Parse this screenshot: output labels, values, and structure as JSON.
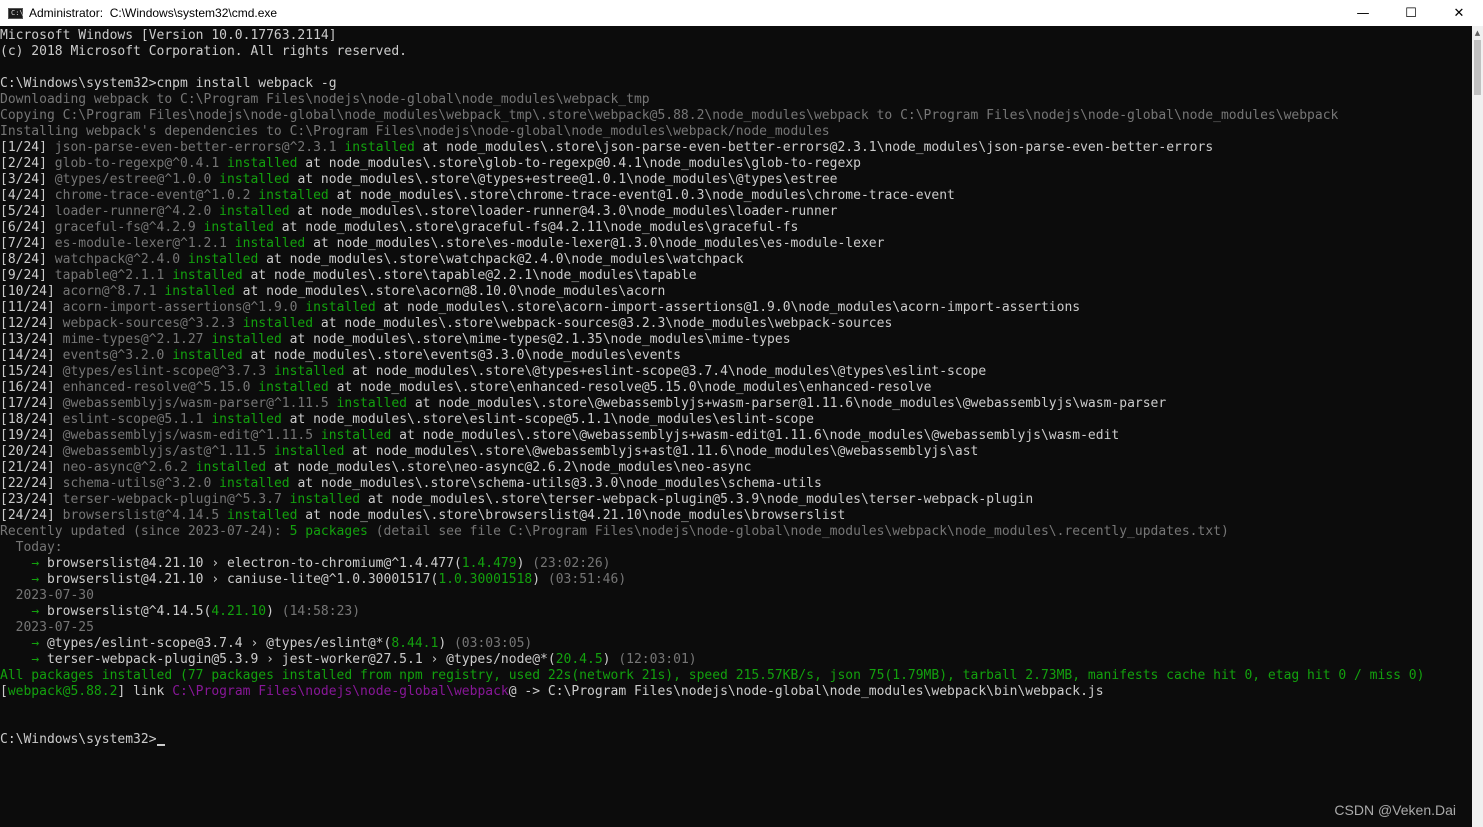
{
  "window": {
    "title": "Administrator:  C:\\Windows\\system32\\cmd.exe",
    "icon_glyph": "C:\\",
    "minimize_glyph": "—",
    "maximize_glyph": "☐",
    "close_glyph": "✕"
  },
  "colors": {
    "background": "#0c0c0c",
    "text": "#cccccc",
    "dim": "#767676",
    "green": "#13a10e",
    "purple": "#881798"
  },
  "console": {
    "lines": [
      [
        [
          "",
          "Microsoft Windows [Version 10.0.17763.2114]"
        ]
      ],
      [
        [
          "",
          "(c) 2018 Microsoft Corporation. All rights reserved."
        ]
      ],
      [],
      [
        [
          "",
          "C:\\Windows\\system32>cnpm install webpack -g"
        ]
      ],
      [
        [
          "dim",
          "Downloading webpack to C:\\Program Files\\nodejs\\node-global\\node_modules\\webpack_tmp"
        ]
      ],
      [
        [
          "dim",
          "Copying C:\\Program Files\\nodejs\\node-global\\node_modules\\webpack_tmp\\.store\\webpack@5.88.2\\node_modules\\webpack to C:\\Program Files\\nodejs\\node-global\\node_modules\\webpack"
        ]
      ],
      [
        [
          "dim",
          "Installing webpack's dependencies to C:\\Program Files\\nodejs\\node-global\\node_modules\\webpack/node_modules"
        ]
      ],
      [
        [
          "",
          "[1/24] "
        ],
        [
          "dim",
          "json-parse-even-better-errors@^2.3.1"
        ],
        [
          "green",
          " installed"
        ],
        [
          "",
          " at node_modules\\.store\\json-parse-even-better-errors@2.3.1\\node_modules\\json-parse-even-better-errors"
        ]
      ],
      [
        [
          "",
          "[2/24] "
        ],
        [
          "dim",
          "glob-to-regexp@^0.4.1"
        ],
        [
          "green",
          " installed"
        ],
        [
          "",
          " at node_modules\\.store\\glob-to-regexp@0.4.1\\node_modules\\glob-to-regexp"
        ]
      ],
      [
        [
          "",
          "[3/24] "
        ],
        [
          "dim",
          "@types/estree@^1.0.0"
        ],
        [
          "green",
          " installed"
        ],
        [
          "",
          " at node_modules\\.store\\@types+estree@1.0.1\\node_modules\\@types\\estree"
        ]
      ],
      [
        [
          "",
          "[4/24] "
        ],
        [
          "dim",
          "chrome-trace-event@^1.0.2"
        ],
        [
          "green",
          " installed"
        ],
        [
          "",
          " at node_modules\\.store\\chrome-trace-event@1.0.3\\node_modules\\chrome-trace-event"
        ]
      ],
      [
        [
          "",
          "[5/24] "
        ],
        [
          "dim",
          "loader-runner@^4.2.0"
        ],
        [
          "green",
          " installed"
        ],
        [
          "",
          " at node_modules\\.store\\loader-runner@4.3.0\\node_modules\\loader-runner"
        ]
      ],
      [
        [
          "",
          "[6/24] "
        ],
        [
          "dim",
          "graceful-fs@^4.2.9"
        ],
        [
          "green",
          " installed"
        ],
        [
          "",
          " at node_modules\\.store\\graceful-fs@4.2.11\\node_modules\\graceful-fs"
        ]
      ],
      [
        [
          "",
          "[7/24] "
        ],
        [
          "dim",
          "es-module-lexer@^1.2.1"
        ],
        [
          "green",
          " installed"
        ],
        [
          "",
          " at node_modules\\.store\\es-module-lexer@1.3.0\\node_modules\\es-module-lexer"
        ]
      ],
      [
        [
          "",
          "[8/24] "
        ],
        [
          "dim",
          "watchpack@^2.4.0"
        ],
        [
          "green",
          " installed"
        ],
        [
          "",
          " at node_modules\\.store\\watchpack@2.4.0\\node_modules\\watchpack"
        ]
      ],
      [
        [
          "",
          "[9/24] "
        ],
        [
          "dim",
          "tapable@^2.1.1"
        ],
        [
          "green",
          " installed"
        ],
        [
          "",
          " at node_modules\\.store\\tapable@2.2.1\\node_modules\\tapable"
        ]
      ],
      [
        [
          "",
          "[10/24] "
        ],
        [
          "dim",
          "acorn@^8.7.1"
        ],
        [
          "green",
          " installed"
        ],
        [
          "",
          " at node_modules\\.store\\acorn@8.10.0\\node_modules\\acorn"
        ]
      ],
      [
        [
          "",
          "[11/24] "
        ],
        [
          "dim",
          "acorn-import-assertions@^1.9.0"
        ],
        [
          "green",
          " installed"
        ],
        [
          "",
          " at node_modules\\.store\\acorn-import-assertions@1.9.0\\node_modules\\acorn-import-assertions"
        ]
      ],
      [
        [
          "",
          "[12/24] "
        ],
        [
          "dim",
          "webpack-sources@^3.2.3"
        ],
        [
          "green",
          " installed"
        ],
        [
          "",
          " at node_modules\\.store\\webpack-sources@3.2.3\\node_modules\\webpack-sources"
        ]
      ],
      [
        [
          "",
          "[13/24] "
        ],
        [
          "dim",
          "mime-types@^2.1.27"
        ],
        [
          "green",
          " installed"
        ],
        [
          "",
          " at node_modules\\.store\\mime-types@2.1.35\\node_modules\\mime-types"
        ]
      ],
      [
        [
          "",
          "[14/24] "
        ],
        [
          "dim",
          "events@^3.2.0"
        ],
        [
          "green",
          " installed"
        ],
        [
          "",
          " at node_modules\\.store\\events@3.3.0\\node_modules\\events"
        ]
      ],
      [
        [
          "",
          "[15/24] "
        ],
        [
          "dim",
          "@types/eslint-scope@^3.7.3"
        ],
        [
          "green",
          " installed"
        ],
        [
          "",
          " at node_modules\\.store\\@types+eslint-scope@3.7.4\\node_modules\\@types\\eslint-scope"
        ]
      ],
      [
        [
          "",
          "[16/24] "
        ],
        [
          "dim",
          "enhanced-resolve@^5.15.0"
        ],
        [
          "green",
          " installed"
        ],
        [
          "",
          " at node_modules\\.store\\enhanced-resolve@5.15.0\\node_modules\\enhanced-resolve"
        ]
      ],
      [
        [
          "",
          "[17/24] "
        ],
        [
          "dim",
          "@webassemblyjs/wasm-parser@^1.11.5"
        ],
        [
          "green",
          " installed"
        ],
        [
          "",
          " at node_modules\\.store\\@webassemblyjs+wasm-parser@1.11.6\\node_modules\\@webassemblyjs\\wasm-parser"
        ]
      ],
      [
        [
          "",
          "[18/24] "
        ],
        [
          "dim",
          "eslint-scope@5.1.1"
        ],
        [
          "green",
          " installed"
        ],
        [
          "",
          " at node_modules\\.store\\eslint-scope@5.1.1\\node_modules\\eslint-scope"
        ]
      ],
      [
        [
          "",
          "[19/24] "
        ],
        [
          "dim",
          "@webassemblyjs/wasm-edit@^1.11.5"
        ],
        [
          "green",
          " installed"
        ],
        [
          "",
          " at node_modules\\.store\\@webassemblyjs+wasm-edit@1.11.6\\node_modules\\@webassemblyjs\\wasm-edit"
        ]
      ],
      [
        [
          "",
          "[20/24] "
        ],
        [
          "dim",
          "@webassemblyjs/ast@^1.11.5"
        ],
        [
          "green",
          " installed"
        ],
        [
          "",
          " at node_modules\\.store\\@webassemblyjs+ast@1.11.6\\node_modules\\@webassemblyjs\\ast"
        ]
      ],
      [
        [
          "",
          "[21/24] "
        ],
        [
          "dim",
          "neo-async@^2.6.2"
        ],
        [
          "green",
          " installed"
        ],
        [
          "",
          " at node_modules\\.store\\neo-async@2.6.2\\node_modules\\neo-async"
        ]
      ],
      [
        [
          "",
          "[22/24] "
        ],
        [
          "dim",
          "schema-utils@^3.2.0"
        ],
        [
          "green",
          " installed"
        ],
        [
          "",
          " at node_modules\\.store\\schema-utils@3.3.0\\node_modules\\schema-utils"
        ]
      ],
      [
        [
          "",
          "[23/24] "
        ],
        [
          "dim",
          "terser-webpack-plugin@^5.3.7"
        ],
        [
          "green",
          " installed"
        ],
        [
          "",
          " at node_modules\\.store\\terser-webpack-plugin@5.3.9\\node_modules\\terser-webpack-plugin"
        ]
      ],
      [
        [
          "",
          "[24/24] "
        ],
        [
          "dim",
          "browserslist@^4.14.5"
        ],
        [
          "green",
          " installed"
        ],
        [
          "",
          " at node_modules\\.store\\browserslist@4.21.10\\node_modules\\browserslist"
        ]
      ],
      [
        [
          "dim",
          "Recently updated (since 2023-07-24): "
        ],
        [
          "green",
          "5 packages"
        ],
        [
          "dim",
          " (detail see file C:\\Program Files\\nodejs\\node-global\\node_modules\\webpack\\node_modules\\.recently_updates.txt)"
        ]
      ],
      [
        [
          "dim",
          "  Today:"
        ]
      ],
      [
        [
          "",
          "    "
        ],
        [
          "green",
          "→"
        ],
        [
          "",
          " browserslist@4.21.10 › electron-to-chromium@^1.4.477("
        ],
        [
          "green",
          "1.4.479"
        ],
        [
          "",
          ") "
        ],
        [
          "dim",
          "(23:02:26)"
        ]
      ],
      [
        [
          "",
          "    "
        ],
        [
          "green",
          "→"
        ],
        [
          "",
          " browserslist@4.21.10 › caniuse-lite@^1.0.30001517("
        ],
        [
          "green",
          "1.0.30001518"
        ],
        [
          "",
          ") "
        ],
        [
          "dim",
          "(03:51:46)"
        ]
      ],
      [
        [
          "dim",
          "  2023-07-30"
        ]
      ],
      [
        [
          "",
          "    "
        ],
        [
          "green",
          "→"
        ],
        [
          "",
          " browserslist@^4.14.5("
        ],
        [
          "green",
          "4.21.10"
        ],
        [
          "",
          ") "
        ],
        [
          "dim",
          "(14:58:23)"
        ]
      ],
      [
        [
          "dim",
          "  2023-07-25"
        ]
      ],
      [
        [
          "",
          "    "
        ],
        [
          "green",
          "→"
        ],
        [
          "",
          " @types/eslint-scope@3.7.4 › @types/eslint@*("
        ],
        [
          "green",
          "8.44.1"
        ],
        [
          "",
          ") "
        ],
        [
          "dim",
          "(03:03:05)"
        ]
      ],
      [
        [
          "",
          "    "
        ],
        [
          "green",
          "→"
        ],
        [
          "",
          " terser-webpack-plugin@5.3.9 › jest-worker@27.5.1 › @types/node@*("
        ],
        [
          "green",
          "20.4.5"
        ],
        [
          "",
          ") "
        ],
        [
          "dim",
          "(12:03:01)"
        ]
      ],
      [
        [
          "green",
          "All packages installed (77 packages installed from npm registry, used 22s(network 21s), speed 215.57KB/s, json 75(1.79MB), tarball 2.73MB, manifests cache hit 0, etag hit 0 / miss 0)"
        ]
      ],
      [
        [
          "",
          "["
        ],
        [
          "green",
          "webpack@5.88.2"
        ],
        [
          "",
          "] link "
        ],
        [
          "purple",
          "C:\\Program Files\\nodejs\\node-global\\webpack"
        ],
        [
          "",
          "@ -> C:\\Program Files\\nodejs\\node-global\\node_modules\\webpack\\bin\\webpack.js"
        ]
      ],
      [],
      [],
      [
        [
          "",
          "C:\\Windows\\system32>"
        ]
      ]
    ],
    "prompt_line_index": 44
  },
  "scrollbar": {
    "up_glyph": "▲"
  },
  "watermark": "CSDN @Veken.Dai"
}
